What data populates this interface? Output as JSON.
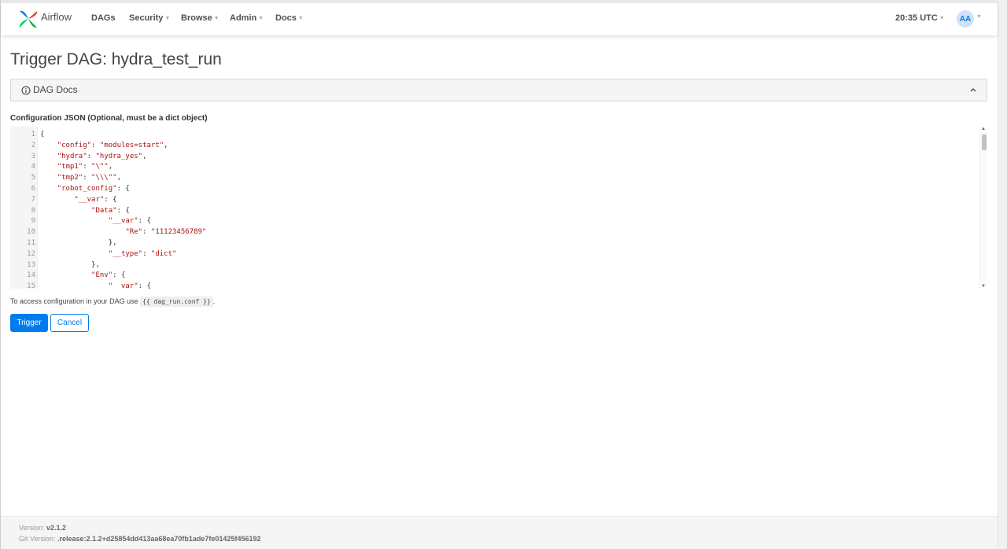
{
  "navbar": {
    "brand": "Airflow",
    "items": [
      {
        "label": "DAGs",
        "dropdown": false
      },
      {
        "label": "Security",
        "dropdown": true
      },
      {
        "label": "Browse",
        "dropdown": true
      },
      {
        "label": "Admin",
        "dropdown": true
      },
      {
        "label": "Docs",
        "dropdown": true
      }
    ],
    "clock": "20:35 UTC",
    "user_initials": "AA"
  },
  "page": {
    "title": "Trigger DAG: hydra_test_run",
    "docs_label": "DAG Docs",
    "config_label": "Configuration JSON (Optional, must be a dict object)"
  },
  "editor": {
    "lines": [
      {
        "n": "1",
        "text": "{"
      },
      {
        "n": "2",
        "text": "    \"config\": \"modules=start\","
      },
      {
        "n": "3",
        "text": "    \"hydra\": \"hydra_yes\","
      },
      {
        "n": "4",
        "text": "    \"tmp1\": \"\\\"\","
      },
      {
        "n": "5",
        "text": "    \"tmp2\": \"\\\\\\\"\","
      },
      {
        "n": "6",
        "text": "    \"robot_config\": {"
      },
      {
        "n": "7",
        "text": "        \"__var\": {"
      },
      {
        "n": "8",
        "text": "            \"Data\": {"
      },
      {
        "n": "9",
        "text": "                \"__var\": {"
      },
      {
        "n": "10",
        "text": "                    \"Re\": \"11123456789\""
      },
      {
        "n": "11",
        "text": "                },"
      },
      {
        "n": "12",
        "text": "                \"__type\": \"dict\""
      },
      {
        "n": "13",
        "text": "            },"
      },
      {
        "n": "14",
        "text": "            \"Env\": {"
      },
      {
        "n": "15",
        "text": "                \"__var\": {"
      }
    ]
  },
  "hint": {
    "prefix": "To access configuration in your DAG use ",
    "code": "{{ dag_run.conf }}",
    "suffix": "."
  },
  "buttons": {
    "trigger": "Trigger",
    "cancel": "Cancel"
  },
  "footer": {
    "version_label": "Version: ",
    "version": "v2.1.2",
    "git_label": "Git Version: ",
    "git": ".release:2.1.2+d25854dd413aa68ea70fb1ade7fe01425f456192"
  },
  "colors": {
    "primary": "#017cee",
    "json_string": "#aa1111"
  },
  "icons": [
    "airflow-logo-icon",
    "info-circle-icon",
    "chevron-up-icon",
    "chevron-down-icon"
  ]
}
